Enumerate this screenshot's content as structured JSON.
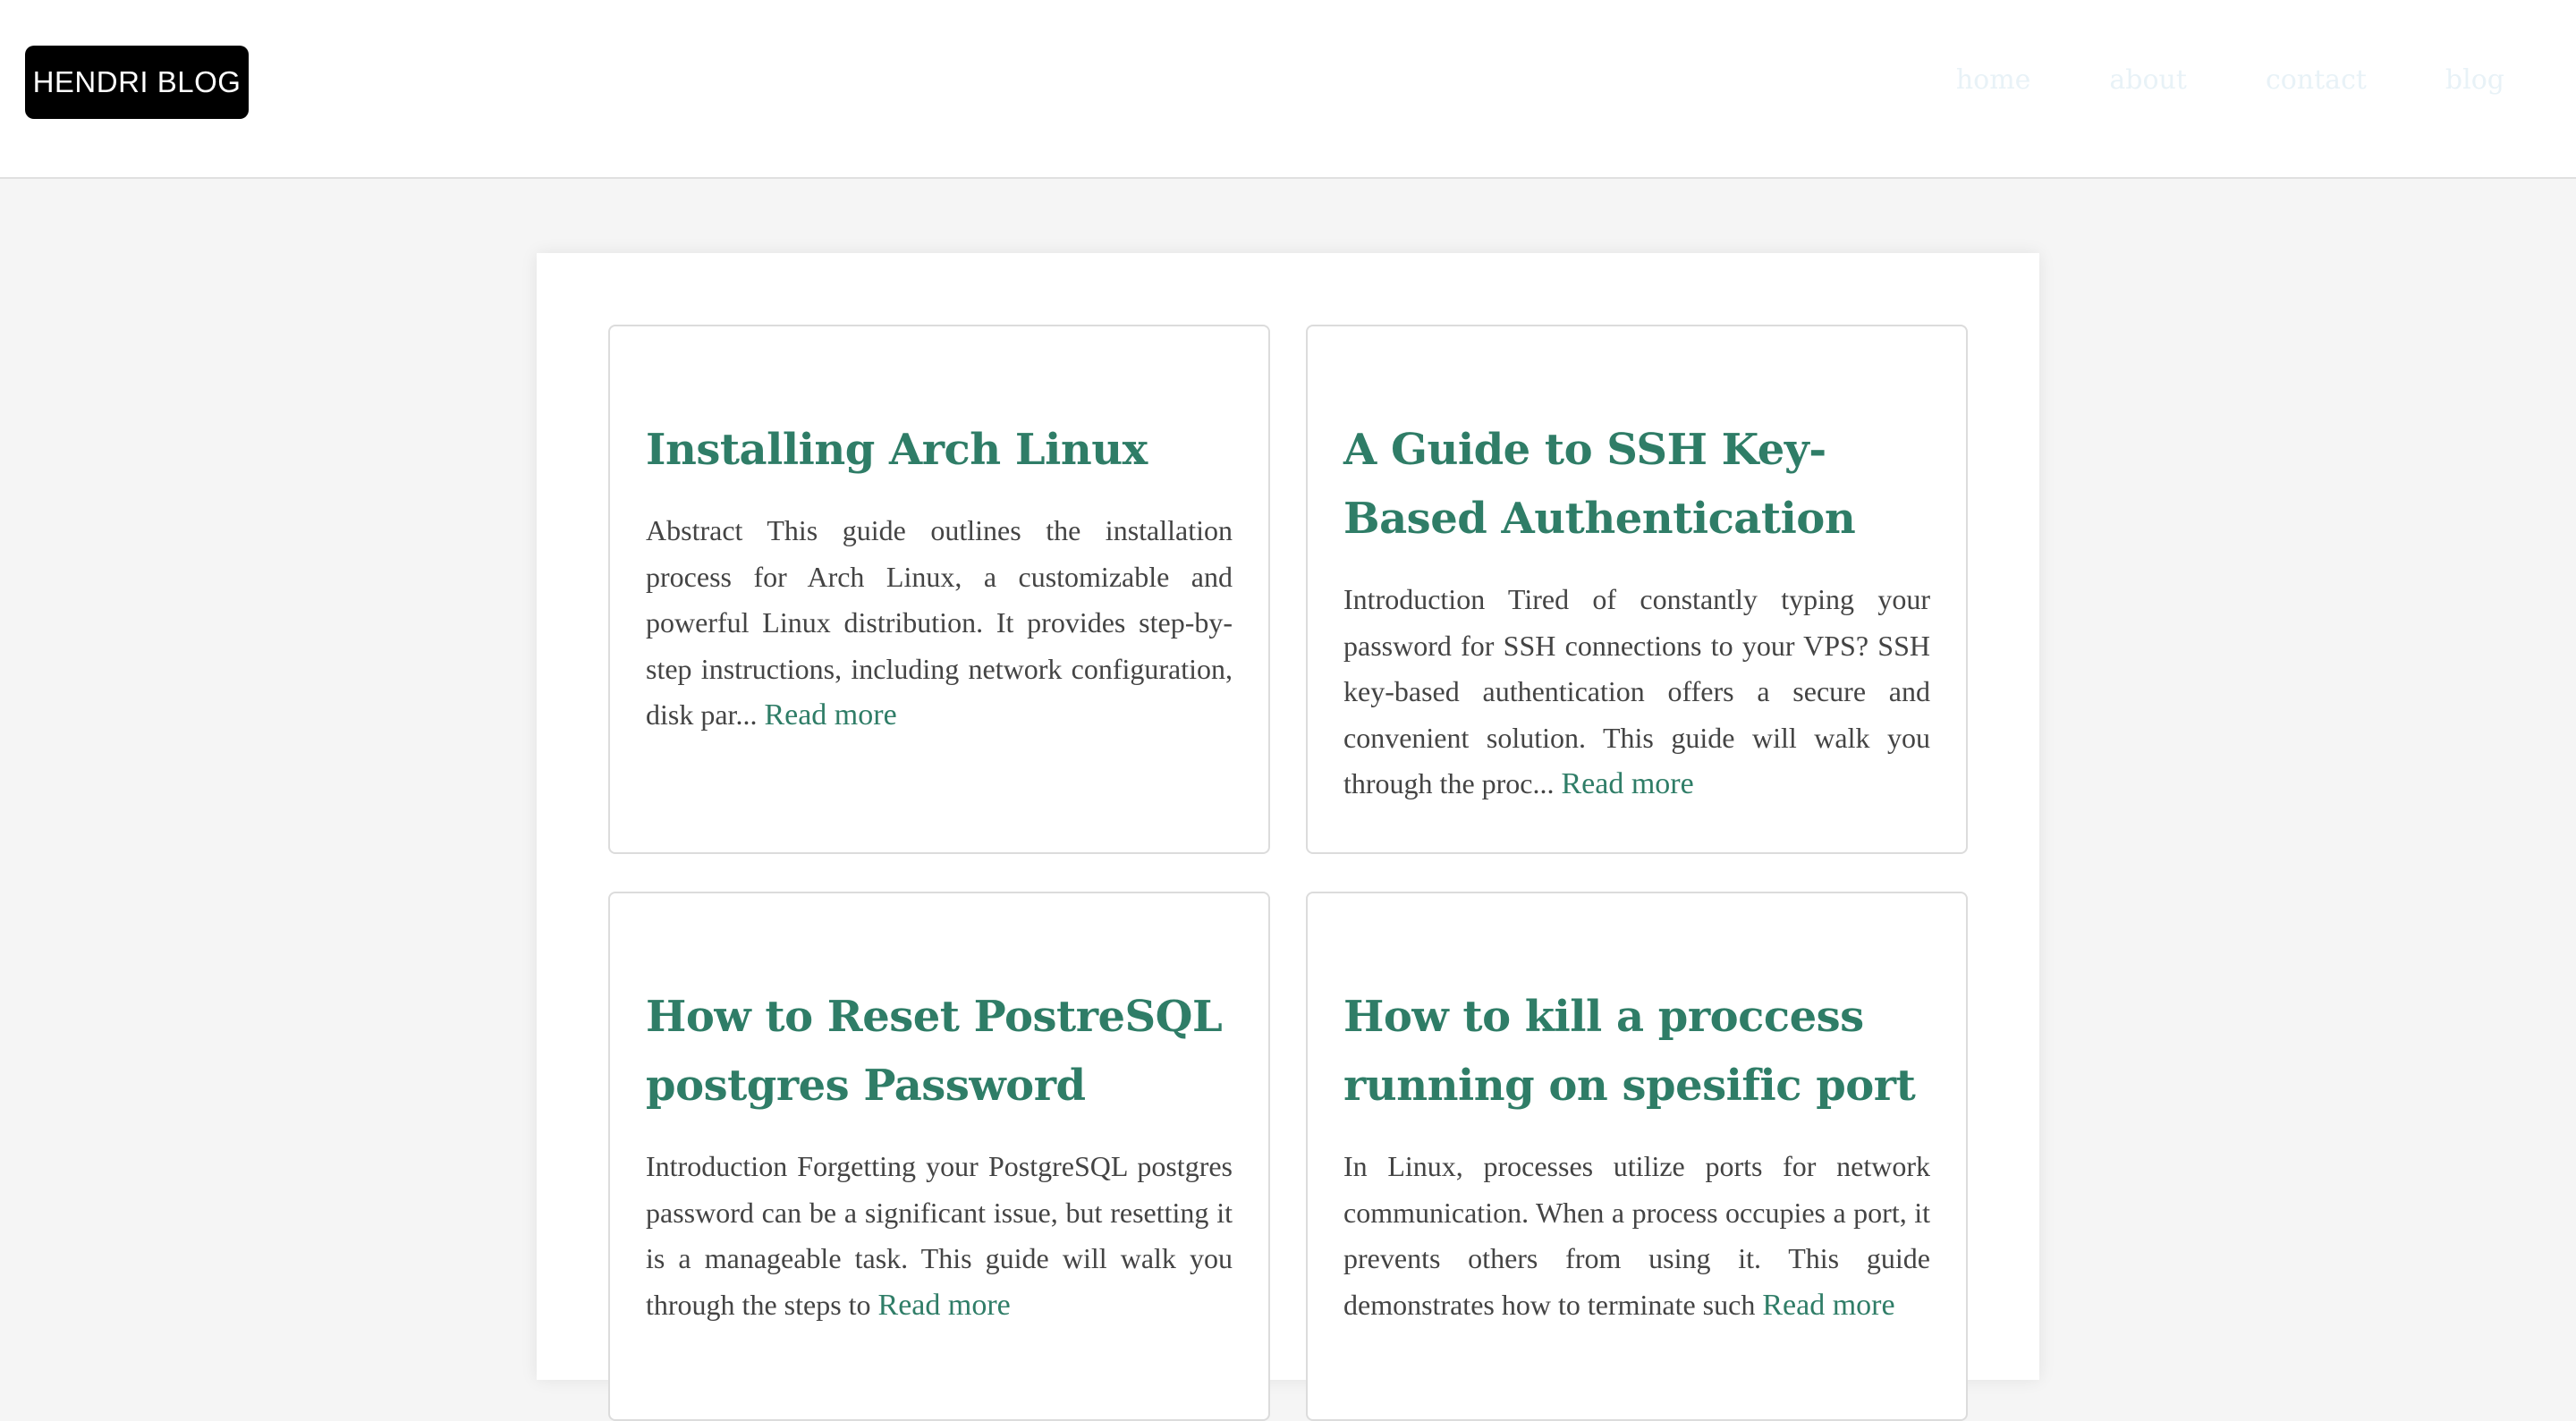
{
  "header": {
    "logo": "HENDRI BLOG",
    "nav": [
      "home",
      "about",
      "contact",
      "blog"
    ]
  },
  "posts": [
    {
      "title": "Installing Arch Linux",
      "excerpt": "Abstract This guide outlines the installation process for Arch Linux, a customizable and powerful Linux distribution. It provides step-by-step instructions, including network configuration, disk par...",
      "read_more": "Read more"
    },
    {
      "title": "A Guide to SSH Key-Based Authentication",
      "excerpt": "Introduction Tired of constantly typing your password for SSH connections to your VPS? SSH key-based authentication offers a secure and convenient solution. This guide will walk you through the proc...",
      "read_more": "Read more"
    },
    {
      "title": "How to Reset PostreSQL postgres Password",
      "excerpt": "Introduction Forgetting your PostgreSQL postgres password can be a significant issue, but resetting it is a manageable task. This guide will walk you through the steps to",
      "read_more": "Read more"
    },
    {
      "title": "How to kill a proccess running on spesific port",
      "excerpt": "In Linux, processes utilize ports for network communication. When a process occupies a port, it prevents others from using it. This guide demonstrates how to terminate such",
      "read_more": "Read more"
    }
  ],
  "colors": {
    "accent": "#2f7d67",
    "text": "#444444",
    "page_bg": "#f5f5f5",
    "logo_bg": "#000000",
    "nav_text": "#e8f2f7"
  }
}
